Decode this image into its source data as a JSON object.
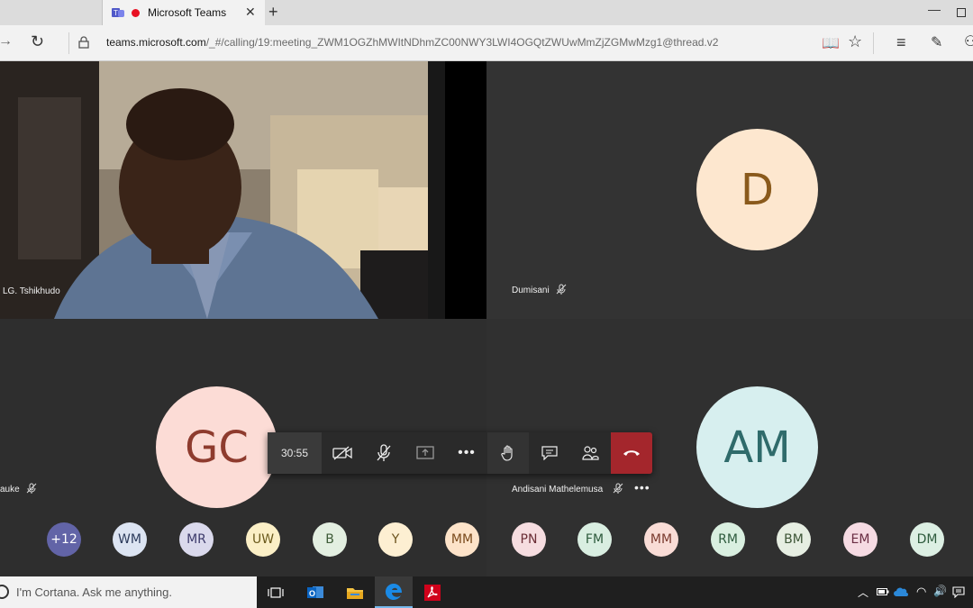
{
  "browser": {
    "tab_title": "Microsoft Teams",
    "url_domain": "teams.microsoft.com",
    "url_path": "/_#/calling/19:meeting_ZWM1OGZhMWItNDhmZC00NWY3LWI4OGQtZWUwMmZjZGMwMzg1@thread.v2"
  },
  "tiles": {
    "video": {
      "name": "LG. Tshikhudo"
    },
    "dumisani": {
      "initial": "D",
      "name": "Dumisani",
      "avatar_bg": "#fde7cf",
      "avatar_fg": "#8a5a1c"
    },
    "gc": {
      "initial": "GC",
      "name": "auke",
      "avatar_bg": "#fcdcd6",
      "avatar_fg": "#8e3b2e"
    },
    "am": {
      "initial": "AM",
      "name": "Andisani Mathelemusa",
      "avatar_bg": "#d7efef",
      "avatar_fg": "#2f6b6b"
    }
  },
  "controls": {
    "timer": "30:55",
    "hangup_color": "#a4262c"
  },
  "participants": [
    {
      "label": "+12",
      "bg": "#6264a7",
      "fg": "#ffffff"
    },
    {
      "label": "WM",
      "bg": "#dce4f2",
      "fg": "#2d3c5c"
    },
    {
      "label": "MR",
      "bg": "#dad9ec",
      "fg": "#3d3b6b"
    },
    {
      "label": "UW",
      "bg": "#fbefc6",
      "fg": "#6b5a1c"
    },
    {
      "label": "B",
      "bg": "#e3efe1",
      "fg": "#3d5b37"
    },
    {
      "label": "Y",
      "bg": "#fdefd2",
      "fg": "#6b521c"
    },
    {
      "label": "MM",
      "bg": "#fde3c9",
      "fg": "#7a4a1c"
    },
    {
      "label": "PN",
      "bg": "#f6dde0",
      "fg": "#6b2e36"
    },
    {
      "label": "FM",
      "bg": "#d9eee1",
      "fg": "#2e5b3d"
    },
    {
      "label": "MM",
      "bg": "#f9dcd6",
      "fg": "#7a3a2e"
    },
    {
      "label": "RM",
      "bg": "#d9efe0",
      "fg": "#2e5b3d"
    },
    {
      "label": "BM",
      "bg": "#e6eee2",
      "fg": "#3d5537"
    },
    {
      "label": "EM",
      "bg": "#f6dbe3",
      "fg": "#6b2e44"
    },
    {
      "label": "DM",
      "bg": "#dcefe3",
      "fg": "#2e5b3d"
    }
  ],
  "taskbar": {
    "cortana_text": "I'm Cortana. Ask me anything."
  }
}
